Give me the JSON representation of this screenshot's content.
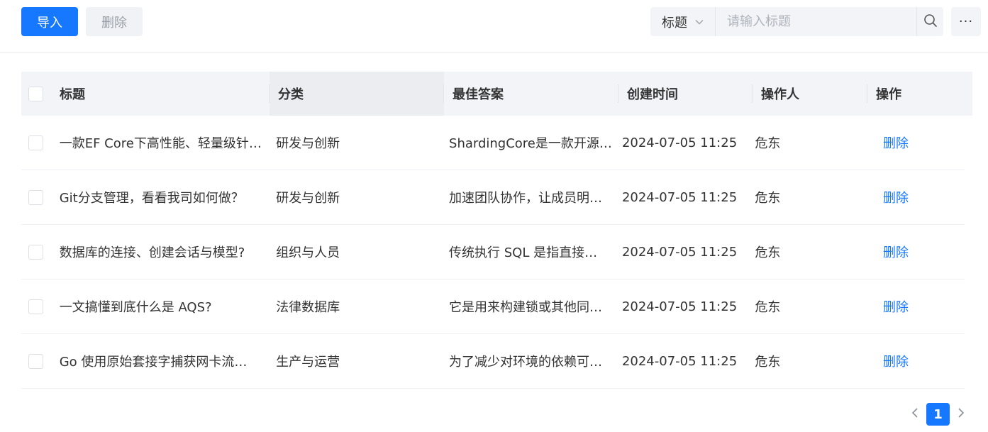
{
  "toolbar": {
    "import_label": "导入",
    "delete_label": "删除",
    "search_field": "标题",
    "search_placeholder": "请输入标题",
    "more_label": "···"
  },
  "table": {
    "columns": [
      "标题",
      "分类",
      "最佳答案",
      "创建时间",
      "操作人",
      "操作"
    ],
    "rows": [
      {
        "title": "一款EF Core下高性能、轻量级针…",
        "category": "研发与创新",
        "answer": "ShardingCore是一款开源…",
        "created": "2024-07-05 11:25",
        "operator": "危东",
        "action": "删除"
      },
      {
        "title": "Git分支管理，看看我司如何做？",
        "category": "研发与创新",
        "answer": "加速团队协作，让成员明…",
        "created": "2024-07-05 11:25",
        "operator": "危东",
        "action": "删除"
      },
      {
        "title": "数据库的连接、创建会话与模型?",
        "category": "组织与人员",
        "answer": "传统执行 SQL 是指直接…",
        "created": "2024-07-05 11:25",
        "operator": "危东",
        "action": "删除"
      },
      {
        "title": "一文搞懂到底什么是 AQS?",
        "category": "法律数据库",
        "answer": "它是用来构建锁或其他同…",
        "created": "2024-07-05 11:25",
        "operator": "危东",
        "action": "删除"
      },
      {
        "title": "Go 使用原始套接字捕获网卡流…",
        "category": "生产与运营",
        "answer": "为了减少对环境的依赖可…",
        "created": "2024-07-05 11:25",
        "operator": "危东",
        "action": "删除"
      }
    ]
  },
  "pagination": {
    "current_page": "1"
  },
  "colors": {
    "primary": "#1677ff",
    "header_bg": "#f2f4f8"
  }
}
